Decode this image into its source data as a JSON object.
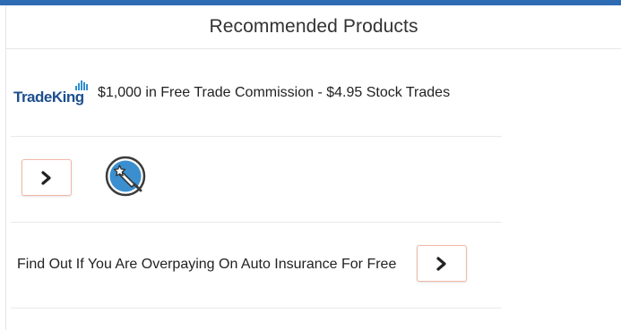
{
  "header": {
    "title": "Recommended Products"
  },
  "products": [
    {
      "logo_text": "TradeKing",
      "text": "$1,000 in Free Trade Commission - $4.95 Stock Trades"
    },
    {
      "button_icon": "chevron-right-icon",
      "image_icon": "magic-wand-icon"
    },
    {
      "text": "Find Out If You Are Overpaying On Auto Insurance For Free",
      "button_icon": "chevron-right-icon"
    }
  ],
  "colors": {
    "top_bar": "#2d6bb3",
    "logo": "#1d4f8f",
    "button_border": "#f2b8a6",
    "icon_blue": "#3b8fcf"
  }
}
